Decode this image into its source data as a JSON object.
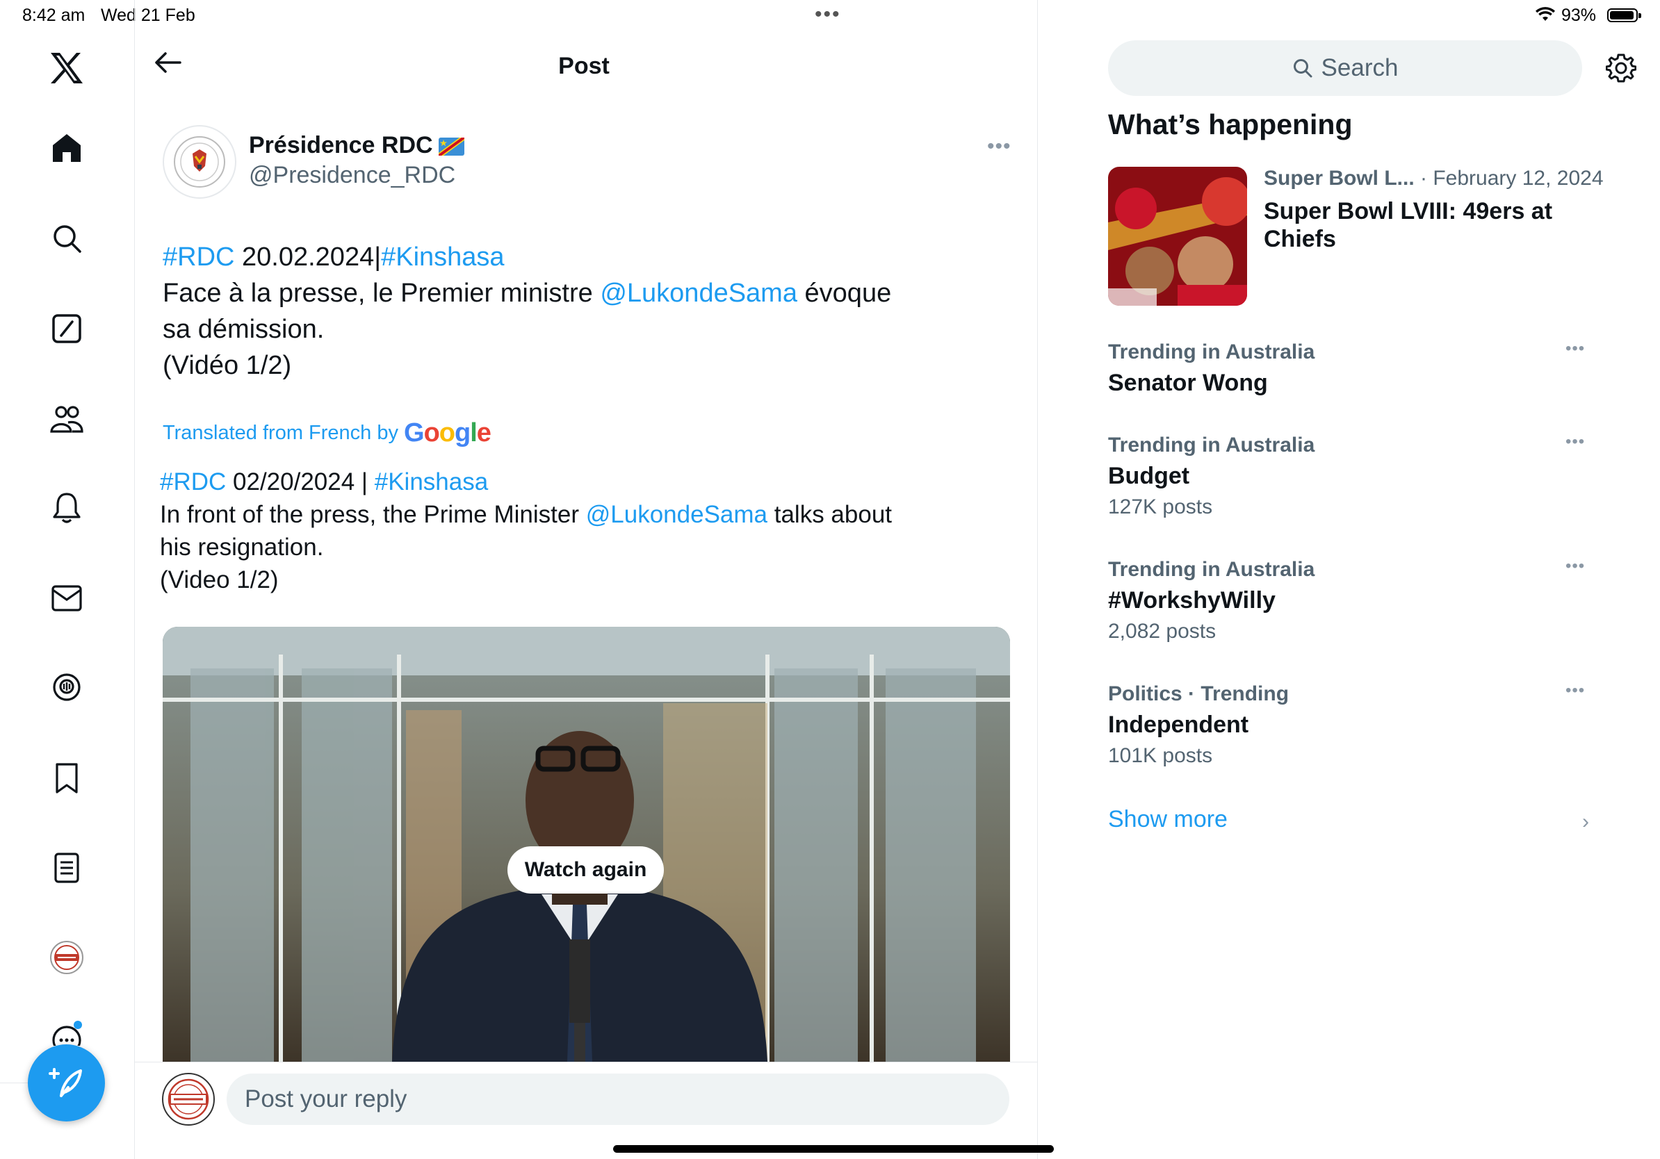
{
  "status": {
    "time": "8:42 am",
    "date": "Wed 21 Feb",
    "battery": "93%"
  },
  "nav": {
    "items": [
      "x-logo",
      "home",
      "search",
      "grok",
      "communities",
      "notifications",
      "messages",
      "spaces",
      "bookmarks",
      "lists",
      "profile",
      "more"
    ]
  },
  "post": {
    "header_title": "Post",
    "author_name": "Présidence RDC",
    "author_handle": "@Presidence_RDC",
    "text": {
      "tag1": "#RDC",
      "date": " 20.02.2024|",
      "tag2": "#Kinshasa",
      "line2_a": "Face à la presse, le Premier ministre ",
      "mention": "@LukondeSama",
      "line2_b": " évoque sa démission.",
      "line3": "(Vidéo 1/2)"
    },
    "translated_label": "Translated from French by",
    "translated_brand": "Google",
    "translation": {
      "tag1": "#RDC",
      "date": " 02/20/2024 | ",
      "tag2": "#Kinshasa",
      "line2_a": "In front of the press, the Prime Minister ",
      "mention": "@LukondeSama",
      "line2_b": " talks about his resignation.",
      "line3": "(Video 1/2)"
    },
    "video_button": "Watch again",
    "reply_placeholder": "Post your reply"
  },
  "sidebar": {
    "search_placeholder": "Search",
    "section_title": "What’s happening",
    "featured": {
      "category": "Super Bowl L...",
      "date": " · February 12, 2024",
      "title": "Super Bowl LVIII: 49ers at Chiefs"
    },
    "trends": [
      {
        "category": "Trending in Australia",
        "name": "Senator Wong",
        "count": ""
      },
      {
        "category": "Trending in Australia",
        "name": "Budget",
        "count": "127K posts"
      },
      {
        "category": "Trending in Australia",
        "name": "#WorkshyWilly",
        "count": "2,082 posts"
      },
      {
        "category": "Politics · Trending",
        "name": "Independent",
        "count": "101K posts"
      }
    ],
    "show_more": "Show more"
  },
  "colors": {
    "accent": "#1d9bf0",
    "text": "#0f1419",
    "secondary": "#536471"
  }
}
